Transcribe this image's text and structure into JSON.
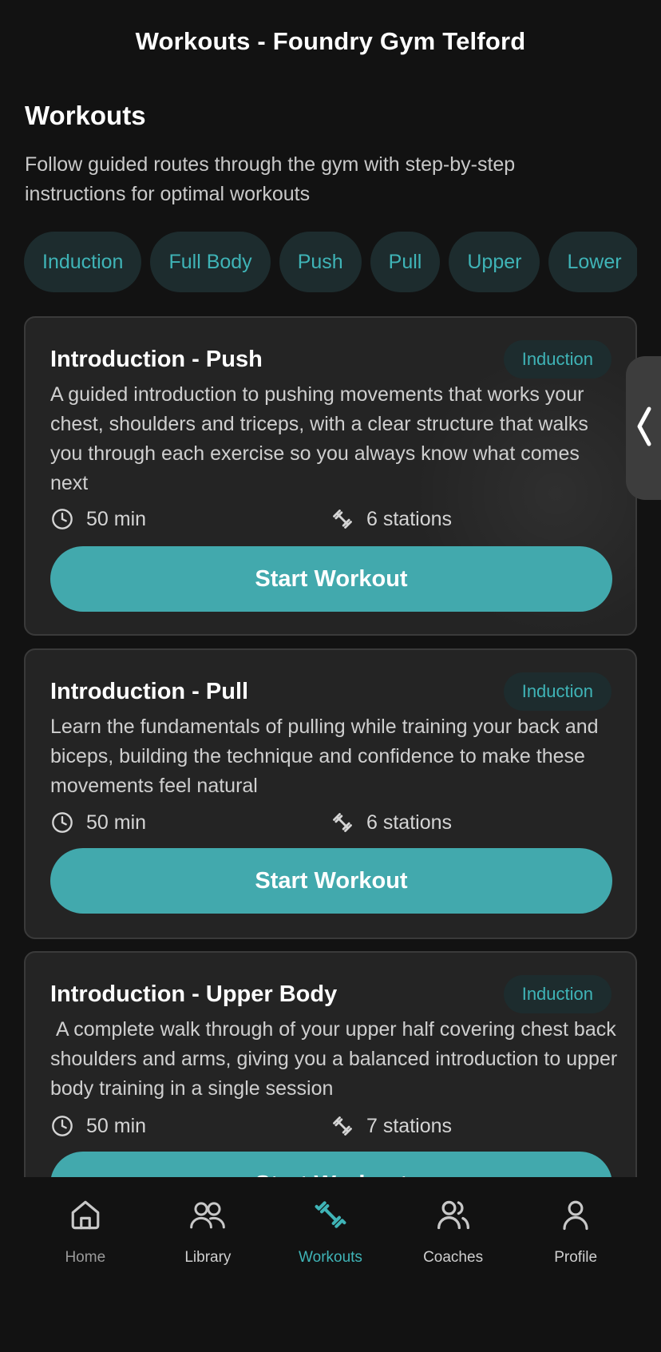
{
  "header": {
    "title": "Workouts - Foundry Gym Telford"
  },
  "intro": {
    "title": "Workouts",
    "subtitle": "Follow guided routes through the gym with step-by-step instructions for optimal workouts"
  },
  "filters": [
    "Induction",
    "Full Body",
    "Push",
    "Pull",
    "Upper",
    "Lower"
  ],
  "workouts": [
    {
      "title": "Introduction - Push",
      "badge": "Induction",
      "description": "A guided introduction to pushing movements that works your chest, shoulders and triceps, with a clear structure that walks you through each exercise so you always know what comes next",
      "duration": "50 min",
      "stations": "6 stations",
      "button": "Start Workout"
    },
    {
      "title": "Introduction - Pull",
      "badge": "Induction",
      "description": "Learn the fundamentals of pulling while training your back and biceps, building the technique and confidence to make these movements feel natural",
      "duration": "50 min",
      "stations": "6 stations",
      "button": "Start Workout"
    },
    {
      "title": "Introduction - Upper Body",
      "badge": "Induction",
      "description": " A complete walk through of your upper half covering chest back shoulders and arms, giving you a balanced introduction to upper body training in a single session",
      "duration": "50 min",
      "stations": "7 stations",
      "button": "Start Workout"
    }
  ],
  "nav": {
    "items": [
      {
        "label": "Home",
        "icon": "home-icon"
      },
      {
        "label": "Library",
        "icon": "library-icon"
      },
      {
        "label": "Workouts",
        "icon": "dumbbell-icon"
      },
      {
        "label": "Coaches",
        "icon": "coaches-icon"
      },
      {
        "label": "Profile",
        "icon": "profile-icon"
      }
    ],
    "active": "Workouts"
  },
  "colors": {
    "background": "#121212",
    "card": "#242424",
    "accent": "#42a9ad",
    "chip_bg": "#1d2c2e",
    "chip_text": "#3fb4b7"
  }
}
